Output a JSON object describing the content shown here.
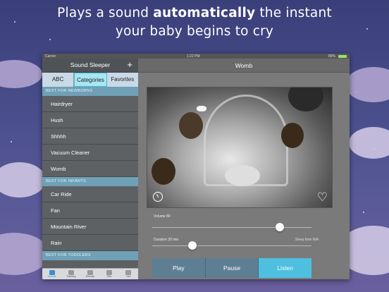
{
  "headline": {
    "line1_pre": "Plays a sound ",
    "line1_bold": "automatically",
    "line1_post": " the instant",
    "line2": "your baby begins to cry"
  },
  "statusbar": {
    "carrier": "Carrier",
    "time": "1:22 PM",
    "battery": "89%"
  },
  "sidebar": {
    "title": "Sound Sleeper",
    "add_icon": "+",
    "segments": [
      "ABC",
      "Categories",
      "Favorites"
    ],
    "active_segment": "Categories",
    "sections": [
      {
        "label": "BEST FOR NEWBORNS",
        "items": [
          "Hairdryer",
          "Hush",
          "Shhhh",
          "Vacuum Cleaner",
          "Womb"
        ]
      },
      {
        "label": "BEST FOR INFANTS",
        "items": [
          "Car Ride",
          "Fan",
          "Mountain River",
          "Rain"
        ]
      },
      {
        "label": "BEST FOR TODDLERS",
        "items": []
      }
    ],
    "tabs": [
      {
        "label": "Sounds",
        "icon": "sounds-icon",
        "active": true
      },
      {
        "label": "Tracking",
        "icon": "tracking-icon",
        "active": false
      },
      {
        "label": "Remote",
        "icon": "remote-icon",
        "active": false
      },
      {
        "label": "Edu",
        "icon": "edu-icon",
        "active": false
      },
      {
        "label": "Info",
        "icon": "info-icon",
        "active": false
      }
    ]
  },
  "main": {
    "title": "Womb",
    "volume_label": "Volume 80",
    "volume_value": 80,
    "duration_label": "Duration 30 min",
    "duration_fraction": 0.25,
    "sleep_label": "Sleep time N/A",
    "buttons": {
      "play": "Play",
      "pause": "Pause",
      "listen": "Listen"
    }
  },
  "colors": {
    "listen": "#4fbfe0",
    "button": "#5e7f93",
    "section": "#6fa0b6"
  }
}
